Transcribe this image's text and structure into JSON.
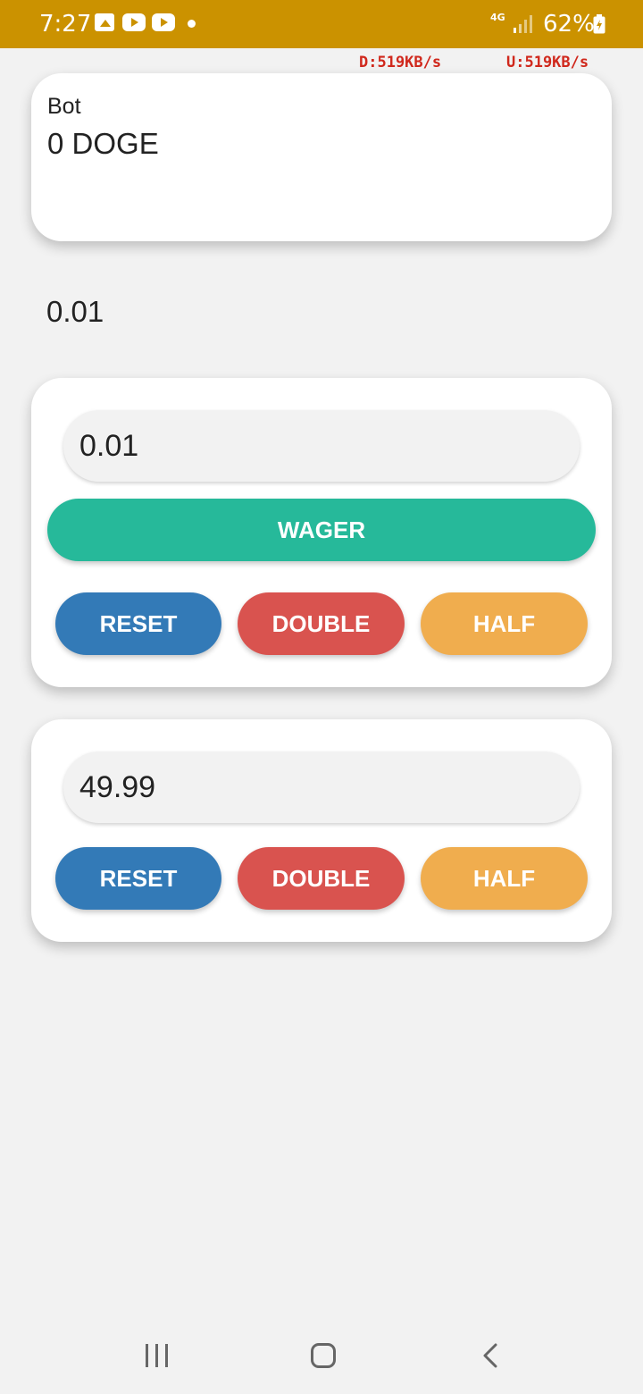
{
  "status_bar": {
    "time": "7:27",
    "network_type": "4G",
    "battery_percent": "62%",
    "icons": [
      "gallery-icon",
      "youtube-icon",
      "youtube-icon",
      "dot-icon",
      "signal-icon",
      "battery-icon"
    ]
  },
  "net_speed": {
    "download": "D:519KB/s",
    "upload": "U:519KB/s"
  },
  "balance_card": {
    "label": "Bot",
    "value": "0 DOGE"
  },
  "standalone_value": "0.01",
  "wager_card": {
    "input_value": "0.01",
    "wager_label": "WAGER",
    "reset_label": "RESET",
    "double_label": "DOUBLE",
    "half_label": "HALF"
  },
  "chance_card": {
    "input_value": "49.99",
    "reset_label": "RESET",
    "double_label": "DOUBLE",
    "half_label": "HALF"
  },
  "colors": {
    "status_bar": "#cb9200",
    "wager_button": "#26b99a",
    "reset_button": "#337ab7",
    "double_button": "#d9534f",
    "half_button": "#f0ad4e",
    "net_speed_text": "#d0281c"
  }
}
